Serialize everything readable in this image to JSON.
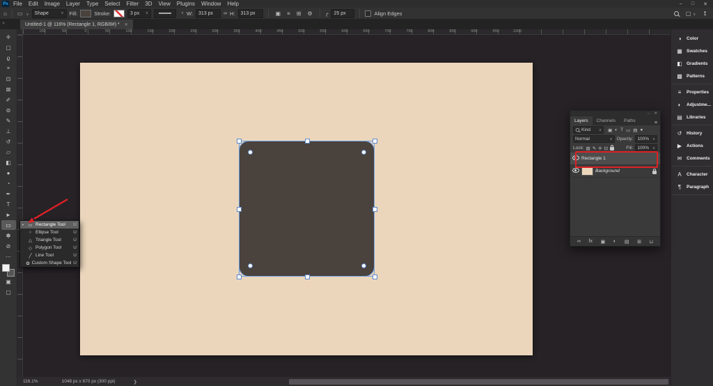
{
  "app": {
    "logo_text": "Ps"
  },
  "menubar": {
    "items": [
      "File",
      "Edit",
      "Image",
      "Layer",
      "Type",
      "Select",
      "Filter",
      "3D",
      "View",
      "Plugins",
      "Window",
      "Help"
    ]
  },
  "window_controls": {
    "minimize": "–",
    "restore": "□",
    "close": "✕"
  },
  "options_bar": {
    "home_icon": "⌂",
    "preset_icon": "▭",
    "mode_value": "Shape",
    "fill_label": "Fill:",
    "stroke_label": "Stroke:",
    "stroke_width_value": "3 px",
    "width_label": "W:",
    "width_value": "313 px",
    "link_icon": "∞",
    "height_label": "H:",
    "height_value": "313 px",
    "op_icons": [
      {
        "name": "path-operations-icon",
        "glyph": "▣"
      },
      {
        "name": "align-icon",
        "glyph": "≡"
      },
      {
        "name": "arrange-icon",
        "glyph": "⊞"
      },
      {
        "name": "settings-gear-icon",
        "glyph": "⚙"
      }
    ],
    "radius_icon": "╭",
    "radius_value": "25 px",
    "align_edges_label": "Align Edges",
    "workspace_icon": "▢",
    "share_icon": "↥"
  },
  "document_tab": {
    "title": "Untitled-1 @ 116% (Rectangle 1, RGB/8#) *",
    "close_icon": "✕"
  },
  "toolbar": {
    "expand_icon": "»",
    "tools": [
      {
        "name": "move-tool",
        "label": "Move Tool",
        "glyph": "✛"
      },
      {
        "name": "marquee-tool",
        "label": "Rectangular Marquee Tool",
        "glyph": "▢"
      },
      {
        "name": "lasso-tool",
        "label": "Lasso Tool",
        "glyph": "ϱ"
      },
      {
        "name": "object-selection-tool",
        "label": "Object Selection Tool",
        "glyph": "⌖"
      },
      {
        "name": "crop-tool",
        "label": "Crop Tool",
        "glyph": "⊡"
      },
      {
        "name": "frame-tool",
        "label": "Frame Tool",
        "glyph": "⊠"
      },
      {
        "name": "eyedropper-tool",
        "label": "Eyedropper Tool",
        "glyph": "✐"
      },
      {
        "name": "healing-brush-tool",
        "label": "Spot Healing Brush Tool",
        "glyph": "⊜"
      },
      {
        "name": "brush-tool",
        "label": "Brush Tool",
        "glyph": "✎"
      },
      {
        "name": "clone-stamp-tool",
        "label": "Clone Stamp Tool",
        "glyph": "⊥"
      },
      {
        "name": "history-brush-tool",
        "label": "History Brush Tool",
        "glyph": "↺"
      },
      {
        "name": "eraser-tool",
        "label": "Eraser Tool",
        "glyph": "▱"
      },
      {
        "name": "gradient-tool",
        "label": "Gradient Tool",
        "glyph": "◧"
      },
      {
        "name": "blur-tool",
        "label": "Blur Tool",
        "glyph": "●"
      },
      {
        "name": "dodge-tool",
        "label": "Dodge Tool",
        "glyph": "◔"
      },
      {
        "name": "pen-tool",
        "label": "Pen Tool",
        "glyph": "✒"
      },
      {
        "name": "type-tool",
        "label": "Horizontal Type Tool",
        "glyph": "T"
      },
      {
        "name": "path-selection-tool",
        "label": "Path Selection Tool",
        "glyph": "►"
      },
      {
        "name": "rectangle-tool",
        "label": "Rectangle Tool",
        "glyph": "▭",
        "selected": true
      },
      {
        "name": "hand-tool",
        "label": "Hand Tool",
        "glyph": "✽"
      },
      {
        "name": "zoom-tool",
        "label": "Zoom Tool",
        "glyph": "⊘"
      },
      {
        "name": "edit-toolbar",
        "label": "Edit Toolbar",
        "glyph": "⋯"
      }
    ],
    "quickmask_icon": "▣",
    "screenmode_icon": "▢"
  },
  "tool_flyout": {
    "current_marker": "▪",
    "items": [
      {
        "name": "rectangle-tool",
        "glyph": "▭",
        "label": "Rectangle Tool",
        "shortcut": "U",
        "selected": true
      },
      {
        "name": "ellipse-tool",
        "glyph": "○",
        "label": "Ellipse Tool",
        "shortcut": "U"
      },
      {
        "name": "triangle-tool",
        "glyph": "△",
        "label": "Triangle Tool",
        "shortcut": "U"
      },
      {
        "name": "polygon-tool",
        "glyph": "◇",
        "label": "Polygon Tool",
        "shortcut": "U"
      },
      {
        "name": "line-tool",
        "glyph": "╱",
        "label": "Line Tool",
        "shortcut": "U"
      },
      {
        "name": "custom-shape-tool",
        "glyph": "✿",
        "label": "Custom Shape Tool",
        "shortcut": "U"
      }
    ]
  },
  "ruler": {
    "h_labels": [
      "100",
      "50",
      "0",
      "50",
      "100",
      "150",
      "200",
      "250",
      "300",
      "350",
      "400",
      "450",
      "500",
      "550",
      "600",
      "650",
      "700",
      "750",
      "800",
      "850",
      "900",
      "950",
      "1000"
    ]
  },
  "layers_panel": {
    "head_collapse_icon": "⇔",
    "head_close_icon": "✕",
    "tabs": [
      {
        "label": "Layers",
        "active": true
      },
      {
        "label": "Channels",
        "active": false
      },
      {
        "label": "Paths",
        "active": false
      }
    ],
    "tab_menu_icon": "≡",
    "kind_value": "Kind",
    "filter_icons": [
      {
        "name": "filter-pixel-layer-icon",
        "glyph": "▣"
      },
      {
        "name": "filter-adjustment-layer-icon",
        "glyph": "◐"
      },
      {
        "name": "filter-type-layer-icon",
        "glyph": "T"
      },
      {
        "name": "filter-shape-layer-icon",
        "glyph": "▭"
      },
      {
        "name": "filter-smart-object-icon",
        "glyph": "▤"
      },
      {
        "name": "filter-toggle-pin-icon",
        "glyph": "●"
      }
    ],
    "blend_mode_value": "Normal",
    "opacity_label": "Opacity:",
    "opacity_value": "100%",
    "lock_label": "Lock:",
    "lock_icons": [
      {
        "name": "lock-transparent-icon",
        "glyph": "▨"
      },
      {
        "name": "lock-paint-icon",
        "glyph": "✎"
      },
      {
        "name": "lock-position-icon",
        "glyph": "✛"
      },
      {
        "name": "lock-artboard-icon",
        "glyph": "⊡"
      }
    ],
    "fill_label": "Fill:",
    "fill_value": "100%",
    "layers": [
      {
        "name": "Rectangle 1",
        "thumb": "shape",
        "selected": true,
        "annotated": true
      },
      {
        "name": "Background",
        "thumb": "background",
        "italic": true,
        "locked": true
      }
    ],
    "bottom_icons": [
      {
        "name": "link-layers-icon",
        "glyph": "∞"
      },
      {
        "name": "layer-effects-icon",
        "glyph": "fx"
      },
      {
        "name": "layer-mask-icon",
        "glyph": "▣"
      },
      {
        "name": "adjustment-layer-icon",
        "glyph": "◐"
      },
      {
        "name": "new-group-icon",
        "glyph": "▤"
      },
      {
        "name": "new-layer-icon",
        "glyph": "⊞"
      },
      {
        "name": "delete-layer-icon",
        "glyph": "⊔"
      }
    ]
  },
  "right_dock": {
    "groups": [
      [
        {
          "icon": "◑",
          "label": "Color"
        },
        {
          "icon": "▦",
          "label": "Swatches"
        },
        {
          "icon": "◧",
          "label": "Gradients"
        },
        {
          "icon": "▩",
          "label": "Patterns"
        }
      ],
      [
        {
          "icon": "≡",
          "label": "Properties"
        },
        {
          "icon": "◐",
          "label": "Adjustme..."
        },
        {
          "icon": "▤",
          "label": "Libraries"
        }
      ],
      [
        {
          "icon": "↺",
          "label": "History"
        },
        {
          "icon": "▶",
          "label": "Actions"
        },
        {
          "icon": "✉",
          "label": "Comments"
        }
      ],
      [
        {
          "icon": "A",
          "label": "Character"
        },
        {
          "icon": "¶",
          "label": "Paragraph"
        }
      ]
    ]
  },
  "status_bar": {
    "zoom_value": "116.1%",
    "doc_info": "1048 px x 670 px (300 ppi)",
    "chevron": "❯"
  },
  "colors": {
    "canvas": "#ebd6bc",
    "shape_fill": "#4a423c",
    "selection": "#6e9ede",
    "annotation_red": "#df2126",
    "accent_blue": "#31a8ff"
  }
}
